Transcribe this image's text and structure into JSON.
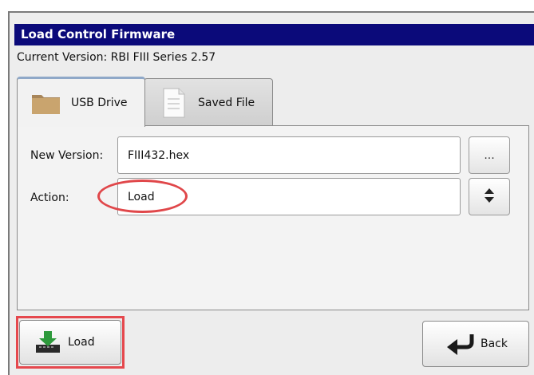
{
  "window": {
    "title": "Load Control Firmware"
  },
  "current_version": "Current Version: RBI FIII Series 2.57",
  "tabs": [
    {
      "label": "USB Drive",
      "icon": "folder-icon",
      "selected": true
    },
    {
      "label": "Saved File",
      "icon": "document-icon",
      "selected": false
    }
  ],
  "form": {
    "new_version_label": "New Version:",
    "new_version_value": "FIII432.hex",
    "browse_label": "...",
    "action_label": "Action:",
    "action_value": "Load"
  },
  "buttons": {
    "load_label": "Load",
    "back_label": "Back"
  },
  "colors": {
    "titlebar": "#0b0a7a",
    "highlight": "#e0474a",
    "load_arrow": "#2e9a3c"
  }
}
